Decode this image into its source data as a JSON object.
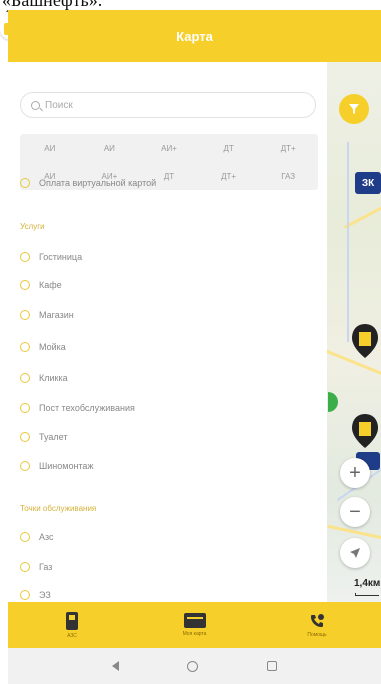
{
  "caption": "«Башнефть».",
  "header": {
    "title": "Карта"
  },
  "search": {
    "placeholder": "Поиск"
  },
  "fuel_types": [
    "АИ",
    "АИ",
    "АИ+",
    "ДТ",
    "ДТ+",
    "АИ",
    "АИ+",
    "ДТ",
    "ДТ+",
    "ГАЗ"
  ],
  "filters": {
    "card_payment": "Оплата виртуальной картой",
    "services_section": "Услуги",
    "services": [
      "Гостиница",
      "Кафе",
      "Магазин",
      "Мойка",
      "Кликка",
      "Пост техобслуживания",
      "Туалет",
      "Шиномонтаж"
    ],
    "payment_section": "Точки обслуживания",
    "payment": [
      "Азс",
      "Газ",
      "ЭЗ"
    ]
  },
  "map": {
    "scale_label": "1,4км",
    "brand_marker": "ЗК"
  },
  "bottom_nav": [
    {
      "label": "АЗС",
      "icon": "fuel-pump-icon"
    },
    {
      "label": "Моя карта",
      "icon": "card-icon"
    },
    {
      "label": "Помощь",
      "icon": "phone-icon"
    }
  ],
  "colors": {
    "accent": "#f7cf2a",
    "brand_blue": "#1f3c88"
  }
}
